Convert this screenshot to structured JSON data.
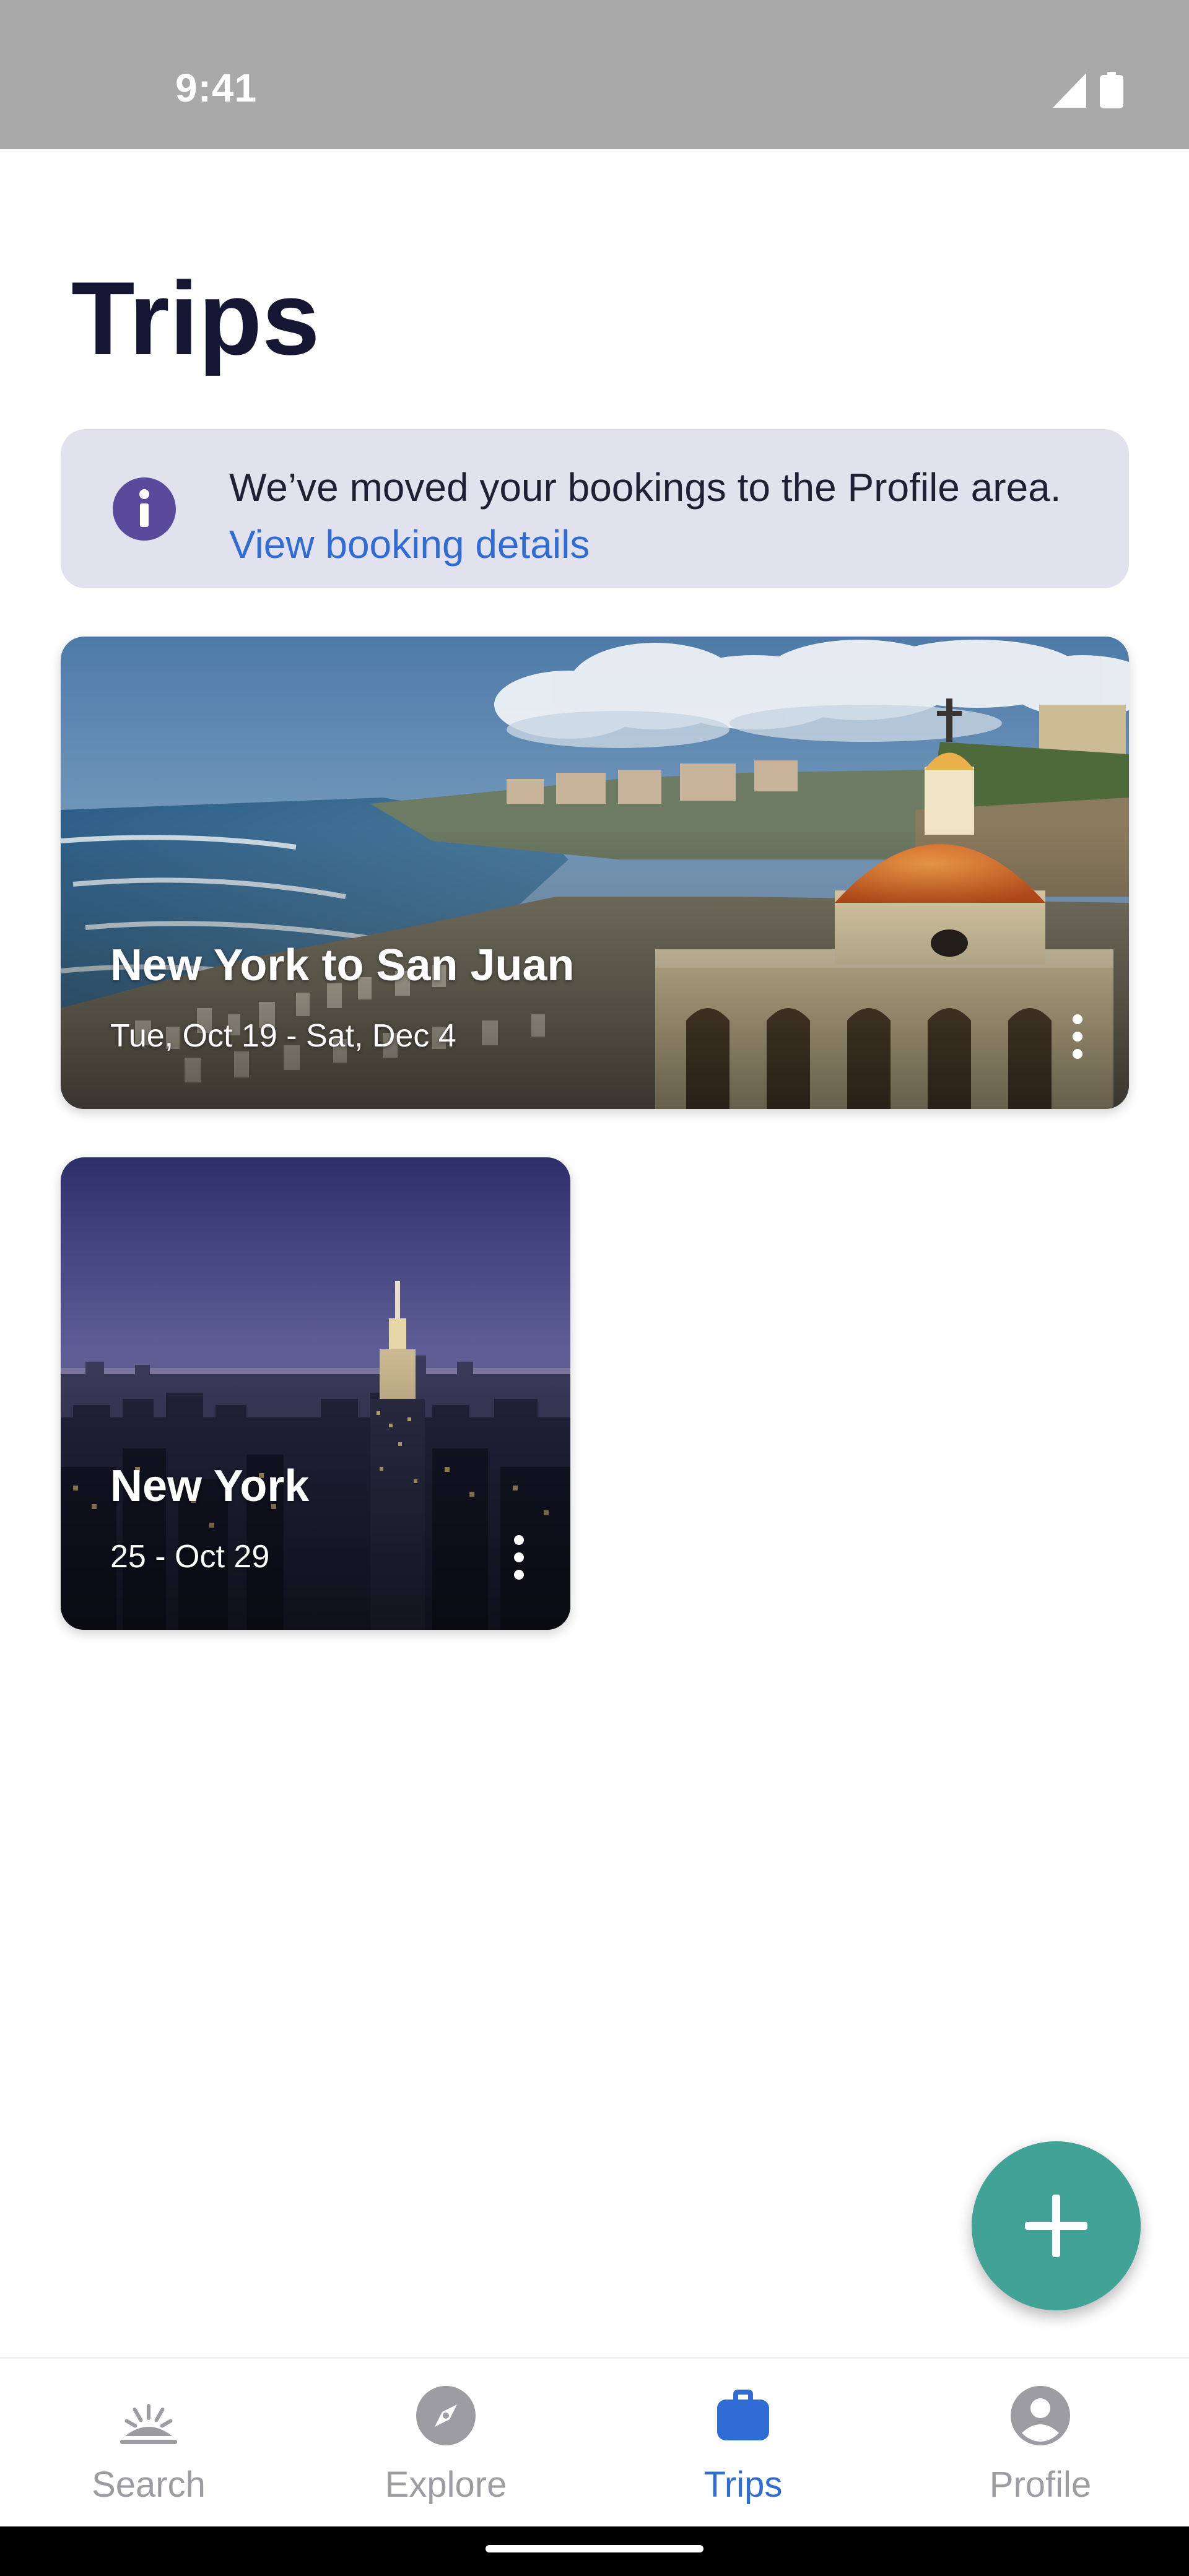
{
  "status_bar": {
    "time": "9:41"
  },
  "page": {
    "title": "Trips"
  },
  "info_banner": {
    "message": "We’ve moved your bookings to the Profile area.",
    "link_label": "View booking details",
    "icon": "info-icon",
    "background": "#e2e1ee",
    "accent": "#5a4a9c"
  },
  "trips": [
    {
      "title": "New York to San Juan",
      "dates": "Tue, Oct 19 - Sat, Dec 4",
      "image": "san-juan-fort-coastline"
    },
    {
      "title": "New York",
      "dates": "25 - Oct 29",
      "image": "new-york-skyline-dusk"
    }
  ],
  "fab": {
    "icon": "plus-icon",
    "color": "#41a395"
  },
  "bottom_nav": {
    "items": [
      {
        "label": "Search",
        "icon": "sunrise-icon",
        "active": false
      },
      {
        "label": "Explore",
        "icon": "compass-icon",
        "active": false
      },
      {
        "label": "Trips",
        "icon": "briefcase-icon",
        "active": true
      },
      {
        "label": "Profile",
        "icon": "account-icon",
        "active": false
      }
    ],
    "active_color": "#2f6cd3",
    "inactive_color": "#9c9ca2"
  }
}
